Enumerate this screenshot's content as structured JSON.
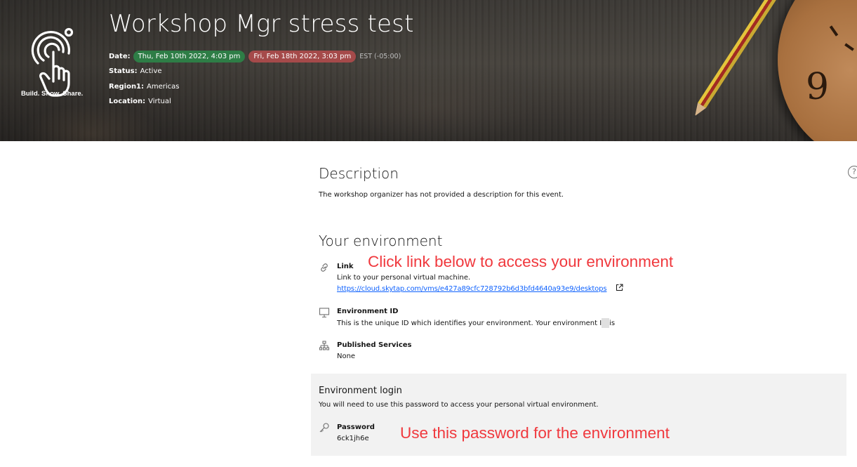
{
  "header": {
    "logo_text": "Build. Show. Share.",
    "title": "Workshop Mgr stress test",
    "date_label": "Date:",
    "start_date": "Thu, Feb 10th 2022, 4:03 pm",
    "end_date": "Fri, Feb 18th 2022, 3:03 pm",
    "timezone": "EST (-05:00)",
    "status_label": "Status:",
    "status_value": "Active",
    "region_label": "Region1:",
    "region_value": "Americas",
    "location_label": "Location:",
    "location_value": "Virtual"
  },
  "description": {
    "title": "Description",
    "text": "The workshop organizer has not provided a description for this event."
  },
  "environment": {
    "title": "Your environment",
    "link": {
      "icon": "link-icon",
      "label": "Link",
      "text": "Link to your personal virtual machine.",
      "url": "https://cloud.skytap.com/vms/e427a89cfc728792b6d3bfd4640a93e9/desktops"
    },
    "env_id": {
      "icon": "monitor-icon",
      "label": "Environment ID",
      "text": "This is the unique ID which identifies your environment. Your environment ID is"
    },
    "services": {
      "icon": "network-icon",
      "label": "Published Services",
      "value": "None"
    }
  },
  "login": {
    "title": "Environment login",
    "text": "You will need to use this password to access your personal virtual environment.",
    "password_icon": "key-icon",
    "password_label": "Password",
    "password_value": "6ck1jh6e"
  },
  "annotations": {
    "link_hint": "Click link below to access your environment",
    "password_hint": "Use this password for the environment"
  },
  "colors": {
    "start_pill": "#2e7d46",
    "end_pill": "#a54a4a",
    "link": "#0f62fe",
    "annotation": "#f0383d",
    "panel": "#f2f2f2"
  }
}
